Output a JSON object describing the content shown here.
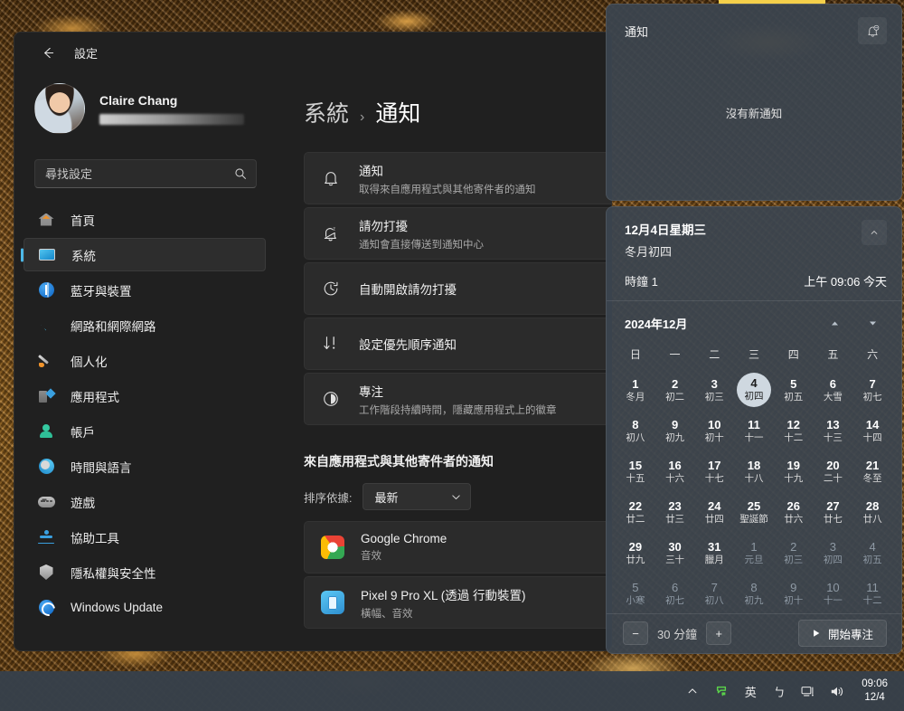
{
  "desktop": {
    "wallpaper_tone": "#7a4f1e"
  },
  "settings_window": {
    "title": "設定",
    "back_icon": "arrow-left-icon",
    "profile": {
      "name": "Claire Chang",
      "email_redacted": ""
    },
    "search": {
      "placeholder": "尋找設定",
      "value": "",
      "icon": "search-icon"
    },
    "nav_items": [
      {
        "label": "首頁",
        "icon": "home-icon",
        "active": false
      },
      {
        "label": "系統",
        "icon": "display-icon",
        "active": true
      },
      {
        "label": "藍牙與裝置",
        "icon": "bluetooth-icon",
        "active": false
      },
      {
        "label": "網路和網際網路",
        "icon": "wifi-icon",
        "active": false
      },
      {
        "label": "個人化",
        "icon": "paintbrush-icon",
        "active": false
      },
      {
        "label": "應用程式",
        "icon": "apps-icon",
        "active": false
      },
      {
        "label": "帳戶",
        "icon": "account-icon",
        "active": false
      },
      {
        "label": "時間與語言",
        "icon": "clock-icon",
        "active": false
      },
      {
        "label": "遊戲",
        "icon": "gamepad-icon",
        "active": false
      },
      {
        "label": "協助工具",
        "icon": "accessibility-icon",
        "active": false
      },
      {
        "label": "隱私權與安全性",
        "icon": "shield-icon",
        "active": false
      },
      {
        "label": "Windows Update",
        "icon": "update-icon",
        "active": false
      }
    ],
    "breadcrumb": {
      "parent": "系統",
      "separator": "›",
      "current": "通知"
    },
    "setting_cards": [
      {
        "title": "通知",
        "subtitle": "取得來自應用程式與其他寄件者的通知",
        "icon": "bell-icon"
      },
      {
        "title": "請勿打擾",
        "subtitle": "通知會直接傳送到通知中心",
        "icon": "bell-sleep-icon"
      },
      {
        "title": "自動開啟請勿打擾",
        "subtitle": "",
        "icon": "clock-arrow-icon"
      },
      {
        "title": "設定優先順序通知",
        "subtitle": "",
        "icon": "priority-icon"
      },
      {
        "title": "專注",
        "subtitle": "工作階段持續時間，隱藏應用程式上的徽章",
        "icon": "focus-icon"
      }
    ],
    "apps_section": {
      "heading": "來自應用程式與其他寄件者的通知",
      "sort_label": "排序依據:",
      "sort_value": "最新",
      "sort_chevron": "chevron-down-icon",
      "apps": [
        {
          "name": "Google Chrome",
          "detail": "音效",
          "icon": "chrome-icon"
        },
        {
          "name": "Pixel 9 Pro XL (透過 行動裝置)",
          "detail": "橫幅、音效",
          "icon": "phone-link-icon"
        }
      ]
    }
  },
  "notification_panel": {
    "title": "通知",
    "dnd_button_icon": "bell-dnd-icon",
    "empty_text": "沒有新通知"
  },
  "calendar_panel": {
    "date_line": "12月4日星期三",
    "lunar_line": "冬月初四",
    "collapse_icon": "chevron-collapse-icon",
    "clock_label": "時鐘 1",
    "clock_value": "上午 09:06 今天",
    "month_label": "2024年12月",
    "prev_icon": "chevron-up-icon",
    "next_icon": "chevron-down-icon",
    "weekdays": [
      "日",
      "一",
      "二",
      "三",
      "四",
      "五",
      "六"
    ],
    "days": [
      {
        "num": "1",
        "lunar": "冬月",
        "out": false,
        "today": false
      },
      {
        "num": "2",
        "lunar": "初二",
        "out": false,
        "today": false
      },
      {
        "num": "3",
        "lunar": "初三",
        "out": false,
        "today": false
      },
      {
        "num": "4",
        "lunar": "初四",
        "out": false,
        "today": true
      },
      {
        "num": "5",
        "lunar": "初五",
        "out": false,
        "today": false
      },
      {
        "num": "6",
        "lunar": "大雪",
        "out": false,
        "today": false
      },
      {
        "num": "7",
        "lunar": "初七",
        "out": false,
        "today": false
      },
      {
        "num": "8",
        "lunar": "初八",
        "out": false,
        "today": false
      },
      {
        "num": "9",
        "lunar": "初九",
        "out": false,
        "today": false
      },
      {
        "num": "10",
        "lunar": "初十",
        "out": false,
        "today": false
      },
      {
        "num": "11",
        "lunar": "十一",
        "out": false,
        "today": false
      },
      {
        "num": "12",
        "lunar": "十二",
        "out": false,
        "today": false
      },
      {
        "num": "13",
        "lunar": "十三",
        "out": false,
        "today": false
      },
      {
        "num": "14",
        "lunar": "十四",
        "out": false,
        "today": false
      },
      {
        "num": "15",
        "lunar": "十五",
        "out": false,
        "today": false
      },
      {
        "num": "16",
        "lunar": "十六",
        "out": false,
        "today": false
      },
      {
        "num": "17",
        "lunar": "十七",
        "out": false,
        "today": false
      },
      {
        "num": "18",
        "lunar": "十八",
        "out": false,
        "today": false
      },
      {
        "num": "19",
        "lunar": "十九",
        "out": false,
        "today": false
      },
      {
        "num": "20",
        "lunar": "二十",
        "out": false,
        "today": false
      },
      {
        "num": "21",
        "lunar": "冬至",
        "out": false,
        "today": false
      },
      {
        "num": "22",
        "lunar": "廿二",
        "out": false,
        "today": false
      },
      {
        "num": "23",
        "lunar": "廿三",
        "out": false,
        "today": false
      },
      {
        "num": "24",
        "lunar": "廿四",
        "out": false,
        "today": false
      },
      {
        "num": "25",
        "lunar": "聖誕節",
        "out": false,
        "today": false
      },
      {
        "num": "26",
        "lunar": "廿六",
        "out": false,
        "today": false
      },
      {
        "num": "27",
        "lunar": "廿七",
        "out": false,
        "today": false
      },
      {
        "num": "28",
        "lunar": "廿八",
        "out": false,
        "today": false
      },
      {
        "num": "29",
        "lunar": "廿九",
        "out": false,
        "today": false
      },
      {
        "num": "30",
        "lunar": "三十",
        "out": false,
        "today": false
      },
      {
        "num": "31",
        "lunar": "臘月",
        "out": false,
        "today": false
      },
      {
        "num": "1",
        "lunar": "元旦",
        "out": true,
        "today": false
      },
      {
        "num": "2",
        "lunar": "初三",
        "out": true,
        "today": false
      },
      {
        "num": "3",
        "lunar": "初四",
        "out": true,
        "today": false
      },
      {
        "num": "4",
        "lunar": "初五",
        "out": true,
        "today": false
      },
      {
        "num": "5",
        "lunar": "小寒",
        "out": true,
        "today": false
      },
      {
        "num": "6",
        "lunar": "初七",
        "out": true,
        "today": false
      },
      {
        "num": "7",
        "lunar": "初八",
        "out": true,
        "today": false
      },
      {
        "num": "8",
        "lunar": "初九",
        "out": true,
        "today": false
      },
      {
        "num": "9",
        "lunar": "初十",
        "out": true,
        "today": false
      },
      {
        "num": "10",
        "lunar": "十一",
        "out": true,
        "today": false
      },
      {
        "num": "11",
        "lunar": "十二",
        "out": true,
        "today": false
      }
    ],
    "focus": {
      "minus_label": "−",
      "plus_label": "+",
      "duration_value": "30",
      "duration_unit": "分鐘",
      "start_label": "開始專注",
      "start_icon": "play-icon"
    }
  },
  "taskbar": {
    "tray": [
      {
        "label": "^",
        "name": "show-hidden-icons-chevron"
      },
      {
        "label": "",
        "name": "ime-status-icon"
      },
      {
        "label": "英",
        "name": "ime-language-icon"
      },
      {
        "label": "ㄅ",
        "name": "ime-bopomofo-icon"
      },
      {
        "label": "",
        "name": "network-icon"
      },
      {
        "label": "",
        "name": "volume-icon"
      }
    ],
    "clock": {
      "time": "09:06",
      "date": "12/4"
    }
  }
}
